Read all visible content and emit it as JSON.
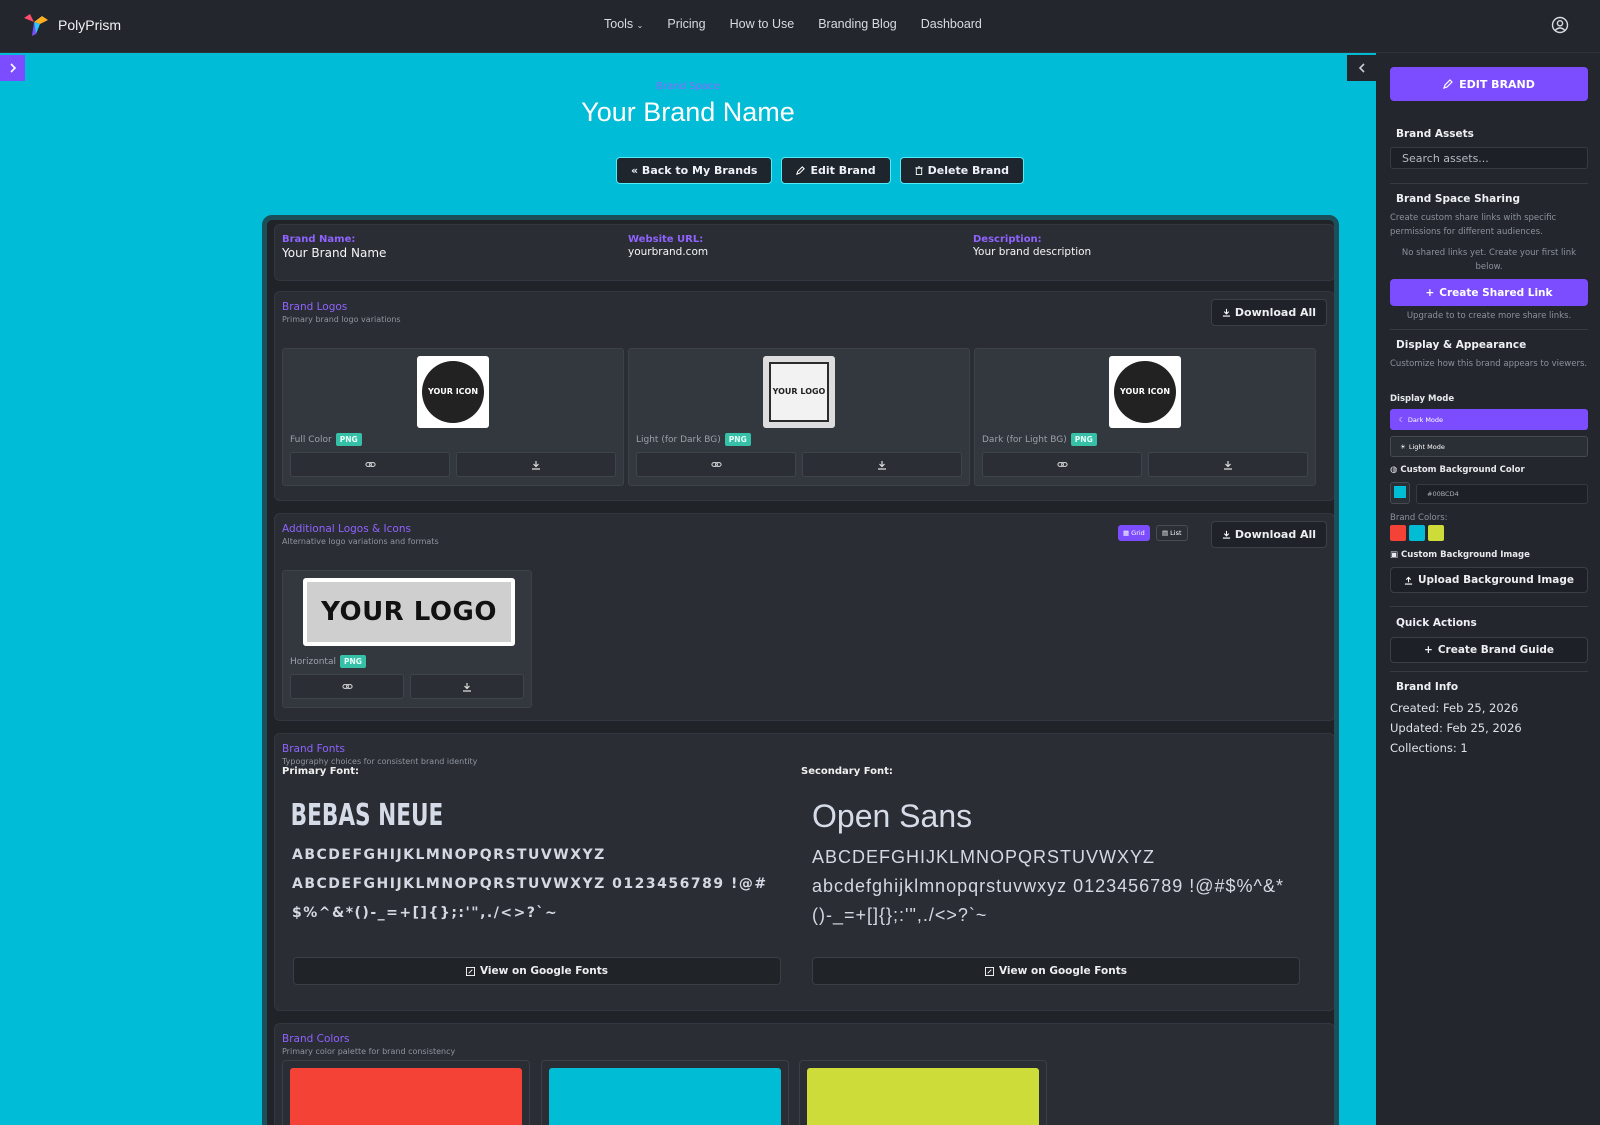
{
  "app": {
    "name": "PolyPrism"
  },
  "nav": {
    "items": [
      "Tools",
      "Pricing",
      "How to Use",
      "Branding Blog",
      "Dashboard"
    ]
  },
  "header": {
    "eyebrow": "Brand Space",
    "title": "Your Brand Name",
    "actions": {
      "back": "« Back to My Brands",
      "edit": "Edit Brand",
      "delete": "Delete Brand"
    }
  },
  "brand_info": {
    "name_label": "Brand Name:",
    "name": "Your Brand Name",
    "url_label": "Website URL:",
    "url": "yourbrand.com",
    "desc_label": "Description:",
    "desc": "Your brand description"
  },
  "brand_logos": {
    "title": "Brand Logos",
    "subtitle": "Primary brand logo variations",
    "download_all": "Download All",
    "items": [
      {
        "thumb_text": "YOUR ICON",
        "label": "Full Color",
        "format": "PNG"
      },
      {
        "thumb_text": "YOUR LOGO",
        "label": "Light (for Dark BG)",
        "format": "PNG"
      },
      {
        "thumb_text": "YOUR ICON",
        "label": "Dark (for Light BG)",
        "format": "PNG"
      }
    ]
  },
  "additional_logos": {
    "title": "Additional Logos & Icons",
    "subtitle": "Alternative logo variations and formats",
    "grid_label": "Grid",
    "list_label": "List",
    "download_all": "Download All",
    "items": [
      {
        "thumb_text": "YOUR LOGO",
        "label": "Horizontal",
        "format": "PNG"
      }
    ]
  },
  "brand_fonts": {
    "title": "Brand Fonts",
    "subtitle": "Typography choices for consistent brand identity",
    "primary": {
      "label": "Primary Font:",
      "name": "BEBAS NEUE",
      "line1": "ABCDEFGHIJKLMNOPQRSTUVWXYZ",
      "line2": "ABCDEFGHIJKLMNOPQRSTUVWXYZ 0123456789 !@#$%^&*()-_=+[]{};:'\",./<>?`~",
      "button": "View on Google Fonts"
    },
    "secondary": {
      "label": "Secondary Font:",
      "name": "Open Sans",
      "line1": "ABCDEFGHIJKLMNOPQRSTUVWXYZ",
      "line2": "abcdefghijklmnopqrstuvwxyz 0123456789 !@#$%^&*()-_=+[]{};:'\",./<>?`~",
      "button": "View on Google Fonts"
    }
  },
  "brand_colors": {
    "title": "Brand Colors",
    "subtitle": "Primary color palette for brand consistency",
    "swatches": [
      "#f44336",
      "#00bcd4",
      "#cddc39"
    ]
  },
  "sidebar": {
    "edit_brand": "EDIT BRAND",
    "assets_title": "Brand Assets",
    "search_placeholder": "Search assets...",
    "sharing_title": "Brand Space Sharing",
    "sharing_desc": "Create custom share links with specific permissions for different audiences.",
    "no_links": "No shared links yet. Create your first link below.",
    "create_link": "Create Shared Link",
    "upgrade_note": "Upgrade to to create more share links.",
    "display_title": "Display & Appearance",
    "display_desc": "Customize how this brand appears to viewers.",
    "display_mode_label": "Display Mode",
    "dark_mode": "Dark Mode",
    "light_mode": "Light Mode",
    "bg_color_label": "Custom Background Color",
    "bg_color_value": "#00BCD4",
    "brand_colors_label": "Brand Colors:",
    "bg_image_label": "Custom Background Image",
    "upload_bg": "Upload Background Image",
    "quick_actions_title": "Quick Actions",
    "create_guide": "Create Brand Guide",
    "info_title": "Brand Info",
    "created": "Created: Feb 25, 2026",
    "updated": "Updated: Feb 25, 2026",
    "collections": "Collections: 1"
  },
  "colors": {
    "accent": "#7c4dff",
    "background": "#00bcd4",
    "badge": "#37c0a8"
  }
}
